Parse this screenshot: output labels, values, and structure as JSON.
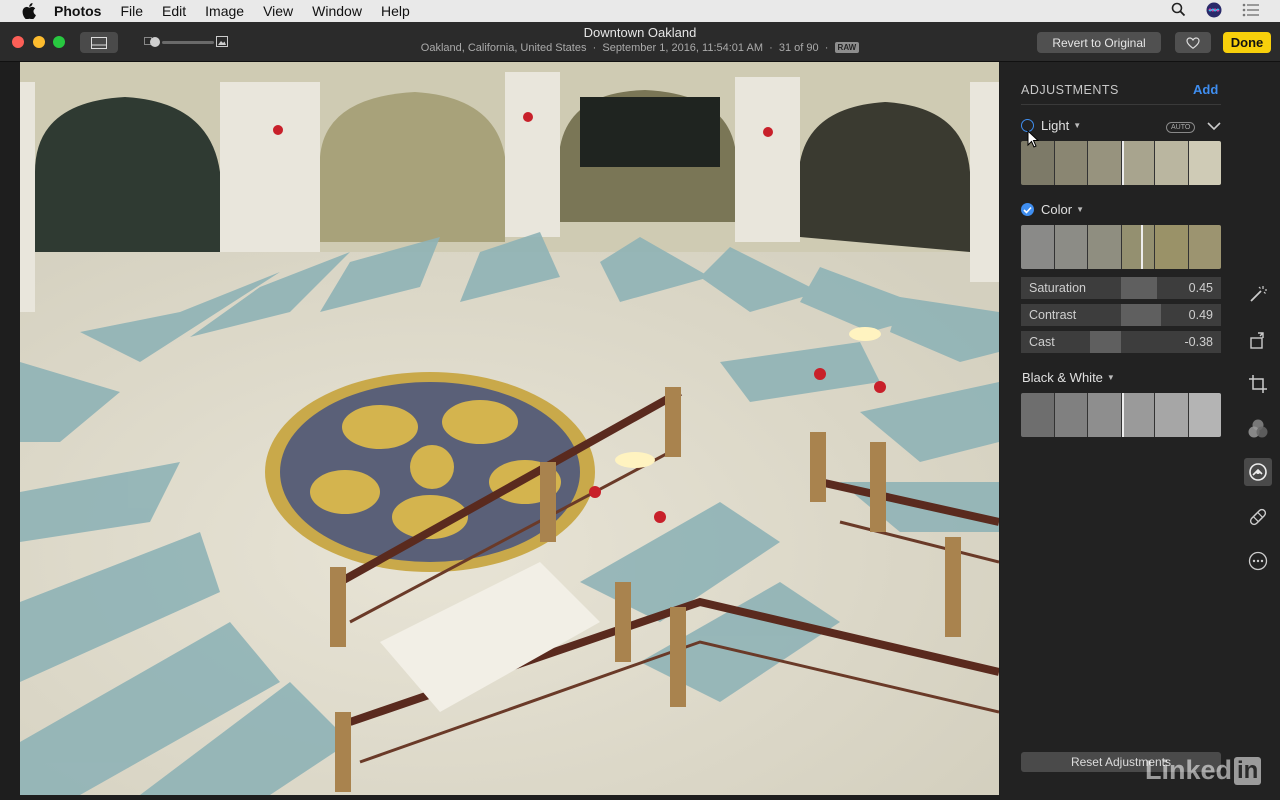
{
  "menubar": {
    "items": [
      "Photos",
      "File",
      "Edit",
      "Image",
      "View",
      "Window",
      "Help"
    ]
  },
  "window": {
    "title": "Downtown Oakland",
    "location": "Oakland, California, United States",
    "date": "September 1, 2016, 11:54:01 AM",
    "position": "31 of 90",
    "raw_badge": "RAW"
  },
  "toolbar": {
    "revert_label": "Revert to Original",
    "done_label": "Done"
  },
  "adjustments": {
    "header": "ADJUSTMENTS",
    "add_label": "Add",
    "light": {
      "label": "Light",
      "auto_badge": "AUTO",
      "enabled": false
    },
    "color": {
      "label": "Color",
      "enabled": true,
      "sliders": [
        {
          "label": "Saturation",
          "value": "0.45",
          "level": 0.45
        },
        {
          "label": "Contrast",
          "value": "0.49",
          "level": 0.49
        },
        {
          "label": "Cast",
          "value": "-0.38",
          "level": -0.38
        }
      ]
    },
    "bw": {
      "label": "Black & White"
    },
    "reset_label": "Reset Adjustments"
  },
  "colors": {
    "accent": "#3f8ef0",
    "done": "#f8d00b"
  },
  "watermark": {
    "text": "Linked",
    "in": "in"
  }
}
